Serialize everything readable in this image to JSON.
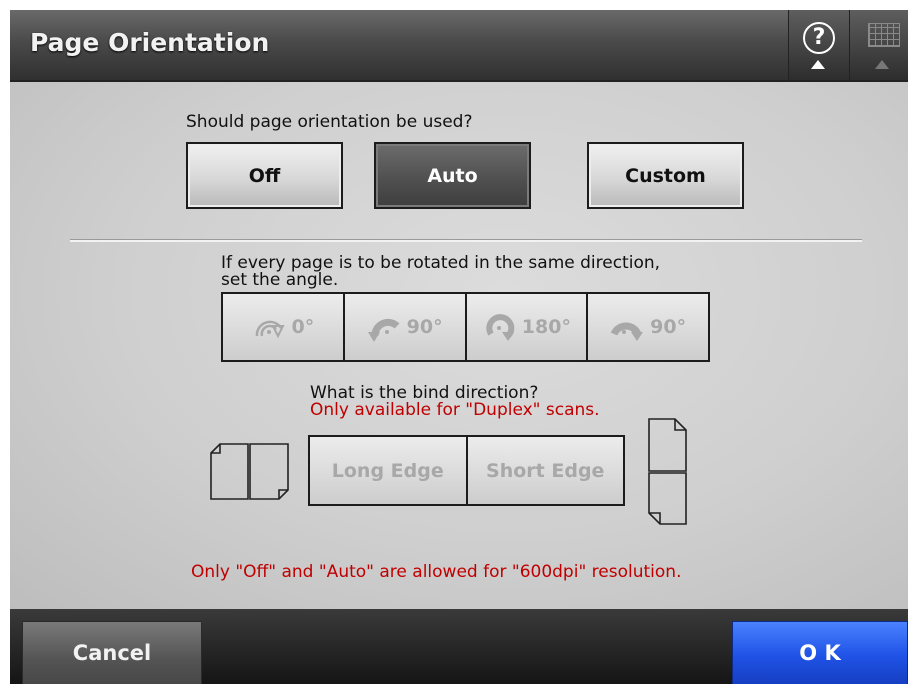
{
  "header": {
    "title": "Page Orientation",
    "help_icon": "help-question-icon",
    "keyboard_icon": "keyboard-icon"
  },
  "orientation": {
    "question": "Should page orientation be used?",
    "options": [
      "Off",
      "Auto",
      "Custom"
    ],
    "selected": "Auto"
  },
  "rotation": {
    "instruction_line1": "If every page is to be rotated in the same direction,",
    "instruction_line2": "set the angle.",
    "options": [
      {
        "label": "0°",
        "icon": "rotate-0-icon"
      },
      {
        "label": "90°",
        "icon": "rotate-left-90-icon"
      },
      {
        "label": "180°",
        "icon": "rotate-180-icon"
      },
      {
        "label": "90°",
        "icon": "rotate-right-90-icon"
      }
    ],
    "enabled": false
  },
  "binding": {
    "question": "What is the bind direction?",
    "note": "Only available for \"Duplex\" scans.",
    "options": [
      "Long Edge",
      "Short Edge"
    ],
    "enabled": false,
    "left_icon": "long-edge-bind-icon",
    "right_icon": "short-edge-bind-icon"
  },
  "warning": "Only \"Off\" and \"Auto\" are allowed for \"600dpi\" resolution.",
  "footer": {
    "cancel_label": "Cancel",
    "ok_label": "O K"
  },
  "colors": {
    "warning_red": "#c00000",
    "ok_blue": "#1f52e6",
    "active_button": "#4e4e4e"
  }
}
